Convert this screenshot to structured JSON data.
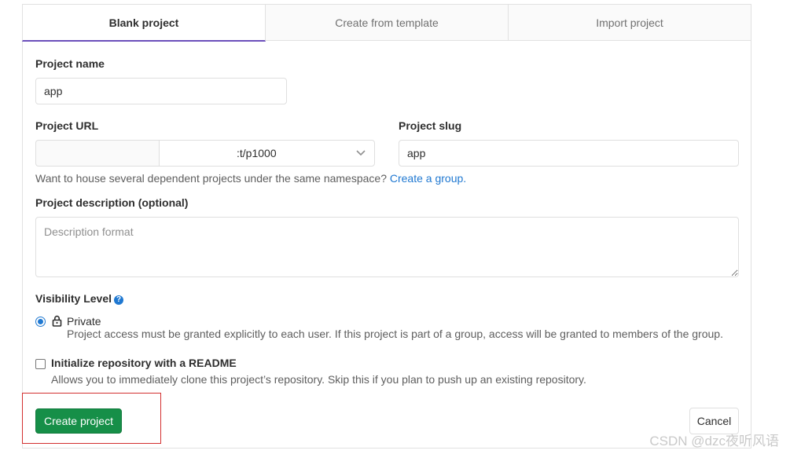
{
  "tabs": [
    {
      "label": "Blank project",
      "active": true
    },
    {
      "label": "Create from template",
      "active": false
    },
    {
      "label": "Import project",
      "active": false
    }
  ],
  "project_name": {
    "label": "Project name",
    "value": "app"
  },
  "project_url": {
    "label": "Project URL",
    "namespace": ":t/p1000"
  },
  "project_slug": {
    "label": "Project slug",
    "value": "app"
  },
  "namespace_help": {
    "text": "Want to house several dependent projects under the same namespace? ",
    "link": "Create a group."
  },
  "description": {
    "label": "Project description (optional)",
    "placeholder": "Description format"
  },
  "visibility": {
    "label": "Visibility Level",
    "help_icon": "question-circle-icon",
    "options": [
      {
        "name": "Private",
        "icon": "lock-icon",
        "selected": true,
        "description": "Project access must be granted explicitly to each user. If this project is part of a group, access will be granted to members of the group."
      }
    ]
  },
  "readme": {
    "label": "Initialize repository with a README",
    "checked": false,
    "description": "Allows you to immediately clone this project’s repository. Skip this if you plan to push up an existing repository."
  },
  "actions": {
    "create": "Create project",
    "cancel": "Cancel"
  },
  "colors": {
    "primary": "#168f48",
    "accent": "#6b4fbb",
    "link": "#1f78d1",
    "highlight": "#d32f2f"
  },
  "watermark": "CSDN @dzc夜听风语"
}
